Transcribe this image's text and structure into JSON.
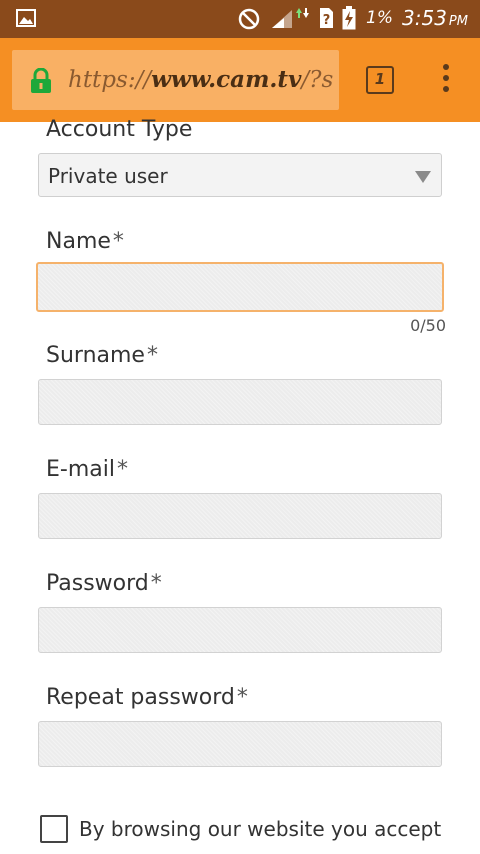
{
  "status_bar": {
    "battery_percent": "1%",
    "time": "3:53",
    "ampm": "PM"
  },
  "browser": {
    "url_scheme": "https://",
    "url_host": "www.cam.tv",
    "url_path": "/?s",
    "tab_count": "1",
    "accent_color": "#f58f23"
  },
  "form": {
    "account_type_label": "Account Type",
    "account_type_value": "Private user",
    "name_label": "Name",
    "name_counter": "0/50",
    "surname_label": "Surname",
    "email_label": "E-mail",
    "password_label": "Password",
    "repeat_password_label": "Repeat password",
    "required_marker": "*",
    "consent_text": "By browsing our website you accept"
  }
}
